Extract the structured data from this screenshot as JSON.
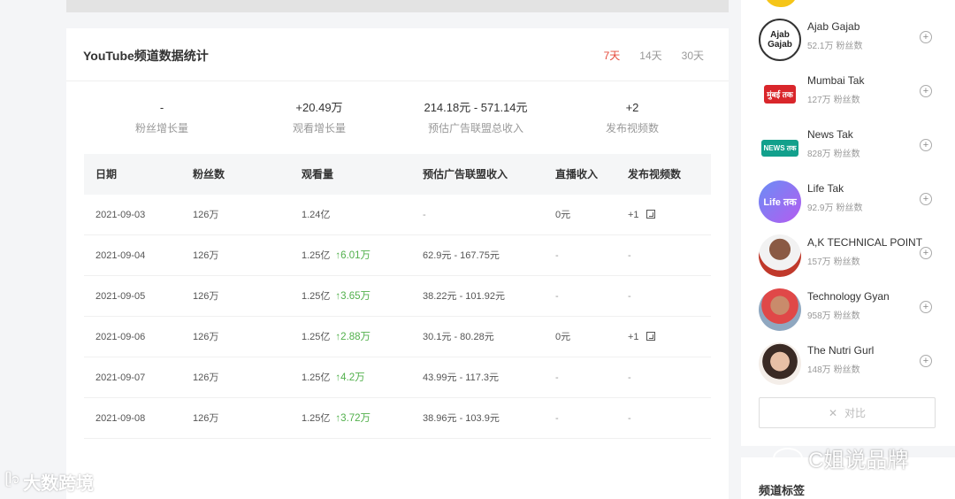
{
  "card": {
    "title": "YouTube频道数据统计",
    "ranges": [
      "7天",
      "14天",
      "30天"
    ],
    "active_range": "7天"
  },
  "summary": [
    {
      "value": "-",
      "label": "粉丝增长量"
    },
    {
      "value": "+20.49万",
      "label": "观看增长量"
    },
    {
      "value": "214.18元 - 571.14元",
      "label": "预估广告联盟总收入"
    },
    {
      "value": "+2",
      "label": "发布视频数"
    }
  ],
  "table": {
    "headers": [
      "日期",
      "粉丝数",
      "观看量",
      "预估广告联盟收入",
      "直播收入",
      "发布视频数"
    ],
    "rows": [
      {
        "date": "2021-09-03",
        "fans": "126万",
        "views": "1.24亿",
        "views_up": "",
        "ad": "-",
        "live": "0元",
        "videos": "+1"
      },
      {
        "date": "2021-09-04",
        "fans": "126万",
        "views": "1.25亿",
        "views_up": "6.01万",
        "ad": "62.9元 - 167.75元",
        "live": "-",
        "videos": "-"
      },
      {
        "date": "2021-09-05",
        "fans": "126万",
        "views": "1.25亿",
        "views_up": "3.65万",
        "ad": "38.22元 - 101.92元",
        "live": "-",
        "videos": "-"
      },
      {
        "date": "2021-09-06",
        "fans": "126万",
        "views": "1.25亿",
        "views_up": "2.88万",
        "ad": "30.1元 - 80.28元",
        "live": "0元",
        "videos": "+1"
      },
      {
        "date": "2021-09-07",
        "fans": "126万",
        "views": "1.25亿",
        "views_up": "4.2万",
        "ad": "43.99元 - 117.3元",
        "live": "-",
        "videos": "-"
      },
      {
        "date": "2021-09-08",
        "fans": "126万",
        "views": "1.25亿",
        "views_up": "3.72万",
        "ad": "38.96元 - 103.9元",
        "live": "-",
        "videos": "-"
      }
    ]
  },
  "sidebar": {
    "channels": [
      {
        "name": "Ajab Gajab",
        "fans": "52.1万",
        "fans_label": "粉丝数",
        "avatar_text": "Ajab Gajab",
        "avatar_color": "#ffffff"
      },
      {
        "name": "Mumbai Tak",
        "fans": "127万",
        "fans_label": "粉丝数",
        "avatar_text": "मुंबई तक",
        "avatar_color": "#d9262b"
      },
      {
        "name": "News Tak",
        "fans": "828万",
        "fans_label": "粉丝数",
        "avatar_text": "NEWS तक",
        "avatar_color": "#12a08c"
      },
      {
        "name": "Life Tak",
        "fans": "92.9万",
        "fans_label": "粉丝数",
        "avatar_text": "Life तक",
        "avatar_color": "#8f6bf0"
      },
      {
        "name": "A,K TECHNICAL POINT",
        "fans": "157万",
        "fans_label": "粉丝数",
        "avatar_text": "",
        "avatar_color": "#b0413e"
      },
      {
        "name": "Technology Gyan",
        "fans": "958万",
        "fans_label": "粉丝数",
        "avatar_text": "",
        "avatar_color": "#7a8fa8"
      },
      {
        "name": "The Nutri Gurl",
        "fans": "148万",
        "fans_label": "粉丝数",
        "avatar_text": "",
        "avatar_color": "#c9a38c"
      }
    ],
    "compare_label": "对比",
    "tags_title": "频道标签"
  },
  "watermarks": {
    "left": "大数跨境",
    "right": "C姐说品牌"
  },
  "colors": {
    "accent": "#e5493a",
    "up": "#52b04c"
  }
}
